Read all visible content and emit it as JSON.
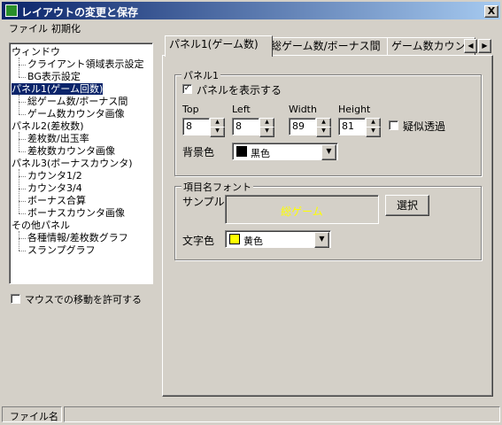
{
  "window": {
    "title": "レイアウトの変更と保存",
    "close_label": "X"
  },
  "menu": {
    "file": "ファイル",
    "reset": "初期化"
  },
  "tree": [
    {
      "label": "ウィンドウ",
      "level": 0
    },
    {
      "label": "クライアント領域表示設定",
      "level": 1
    },
    {
      "label": "BG表示設定",
      "level": 1
    },
    {
      "label": "パネル1(ゲーム回数)",
      "level": 0,
      "selected": true
    },
    {
      "label": "総ゲーム数/ボーナス間",
      "level": 1
    },
    {
      "label": "ゲーム数カウンタ画像",
      "level": 1
    },
    {
      "label": "パネル2(差枚数)",
      "level": 0
    },
    {
      "label": "差枚数/出玉率",
      "level": 1
    },
    {
      "label": "差枚数カウンタ画像",
      "level": 1
    },
    {
      "label": "パネル3(ボーナスカウンタ)",
      "level": 0
    },
    {
      "label": "カウンタ1/2",
      "level": 1
    },
    {
      "label": "カウンタ3/4",
      "level": 1
    },
    {
      "label": "ボーナス合算",
      "level": 1
    },
    {
      "label": "ボーナスカウンタ画像",
      "level": 1
    },
    {
      "label": "その他パネル",
      "level": 0
    },
    {
      "label": "各種情報/差枚数グラフ",
      "level": 1
    },
    {
      "label": "スランプグラフ",
      "level": 1
    }
  ],
  "mouse_move": {
    "label": "マウスでの移動を許可する",
    "checked": false
  },
  "tabs": [
    "パネル1(ゲーム数)",
    "総ゲーム数/ボーナス間",
    "ゲーム数カウン"
  ],
  "tab_scroll": {
    "left": "◀",
    "right": "▶"
  },
  "panel": {
    "group_title": "パネル1",
    "show_label": "パネルを表示する",
    "show_checked": true,
    "top_label": "Top",
    "top_value": "8",
    "left_label": "Left",
    "left_value": "8",
    "width_label": "Width",
    "width_value": "89",
    "height_label": "Height",
    "height_value": "81",
    "pseudo_label": "疑似透過",
    "pseudo_checked": false,
    "bg_label": "背景色",
    "bg_value": "黒色",
    "bg_color": "#000000"
  },
  "font": {
    "group_title": "項目名フォント",
    "sample_label": "サンプル",
    "sample_text": "総ゲーム",
    "sample_color": "#ffff00",
    "select_label": "選択",
    "color_label": "文字色",
    "color_value": "黄色",
    "color_hex": "#ffff00"
  },
  "status": {
    "file_label": "ファイル名",
    "file_value": ""
  }
}
